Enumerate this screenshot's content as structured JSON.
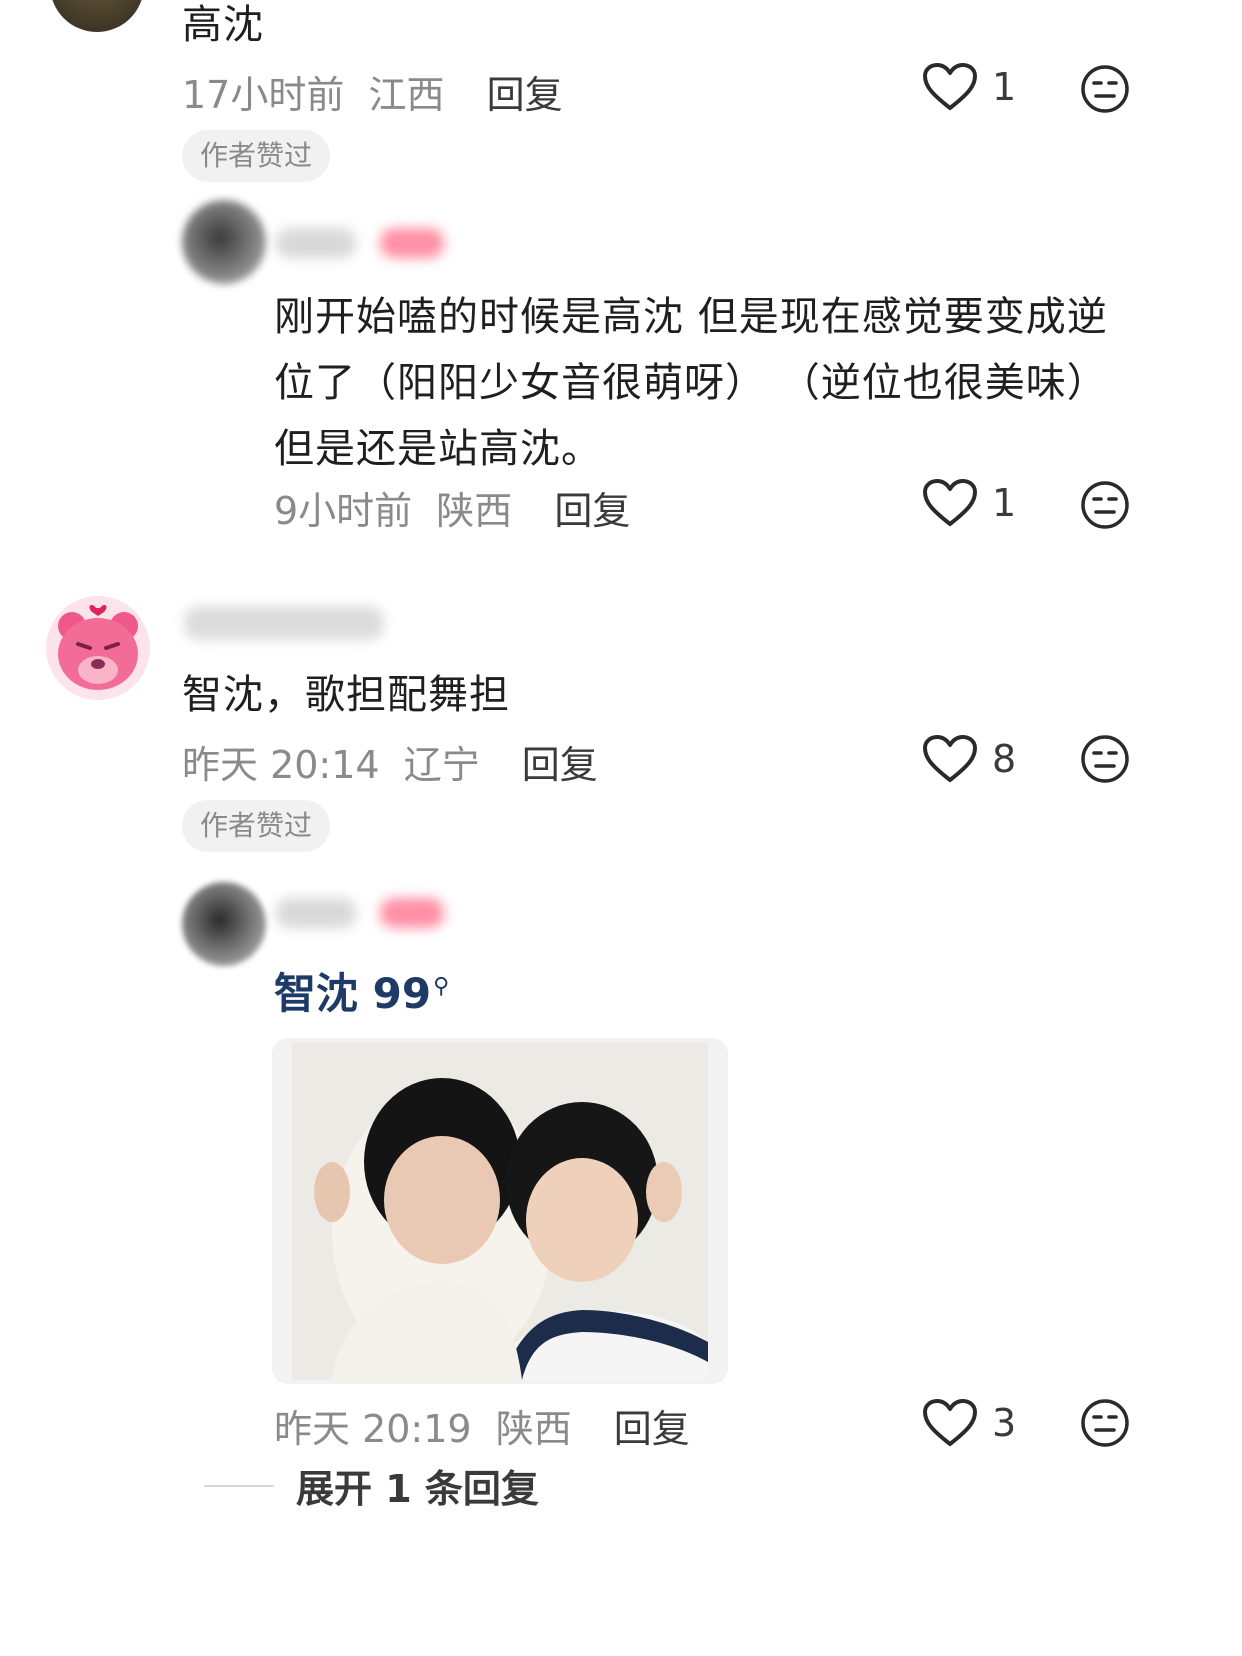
{
  "comments": [
    {
      "text": "高沈",
      "time": "17小时前",
      "location": "江西",
      "reply_label": "回复",
      "likes": "1",
      "author_liked_tag": "作者赞过"
    },
    {
      "text": "刚开始嗑的时候是高沈 但是现在感觉要变成逆位了（阳阳少女音很萌呀） （逆位也很美味）但是还是站高沈。",
      "time": "9小时前",
      "location": "陕西",
      "reply_label": "回复",
      "likes": "1"
    },
    {
      "text": "智沈，歌担配舞担",
      "time": "昨天 20:14",
      "location": "辽宁",
      "reply_label": "回复",
      "likes": "8",
      "author_liked_tag": "作者赞过"
    },
    {
      "search_text": "智沈 99",
      "time": "昨天 20:19",
      "location": "陕西",
      "reply_label": "回复",
      "likes": "3"
    }
  ],
  "expand_replies": "展开 1 条回复",
  "icons": {
    "like": "heart-outline-icon",
    "dislike": "neutral-face-icon",
    "search_hint": "search-icon"
  },
  "colors": {
    "meta_gray": "#8a8a8a",
    "link_blue": "#1e3a66",
    "tag_bg": "#f1f1f1",
    "author_badge_pink": "#ff5a7a"
  }
}
